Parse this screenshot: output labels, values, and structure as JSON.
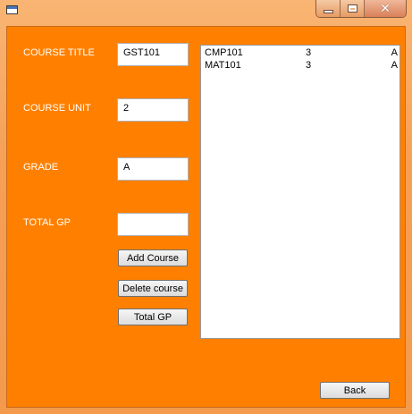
{
  "window": {
    "icon": "app-window-icon",
    "controls": {
      "minimize": "minimize-icon",
      "maximize": "maximize-icon",
      "close": "close-icon"
    }
  },
  "form": {
    "course_title_label": "COURSE TITLE",
    "course_title_value": "GST101",
    "course_unit_label": "COURSE UNIT",
    "course_unit_value": "2",
    "grade_label": "GRADE",
    "grade_value": "A",
    "total_gp_label": "TOTAL GP",
    "total_gp_value": ""
  },
  "buttons": {
    "add_course": "Add Course",
    "delete_course": "Delete course",
    "total_gp": "Total GP",
    "back": "Back"
  },
  "courses": [
    {
      "code": "CMP101",
      "unit": "3",
      "grade": "A"
    },
    {
      "code": "MAT101",
      "unit": "3",
      "grade": "A"
    }
  ],
  "colors": {
    "background": "#ff8000",
    "label_text": "#ffffff"
  }
}
